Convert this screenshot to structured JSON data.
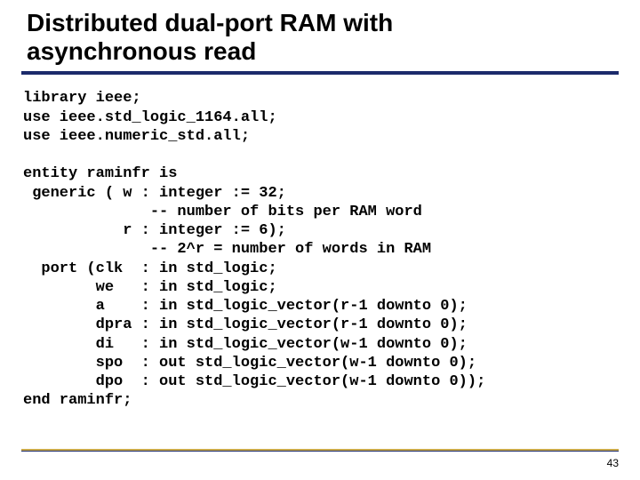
{
  "title_line1": "Distributed dual-port RAM with",
  "title_line2": "asynchronous read",
  "code_block": "library ieee;\nuse ieee.std_logic_1164.all;\nuse ieee.numeric_std.all;\n\nentity raminfr is\n generic ( w : integer := 32;\n              -- number of bits per RAM word\n           r : integer := 6);\n              -- 2^r = number of words in RAM\n  port (clk  : in std_logic;\n        we   : in std_logic;\n        a    : in std_logic_vector(r-1 downto 0);\n        dpra : in std_logic_vector(r-1 downto 0);\n        di   : in std_logic_vector(w-1 downto 0);\n        spo  : out std_logic_vector(w-1 downto 0);\n        dpo  : out std_logic_vector(w-1 downto 0));\nend raminfr;",
  "page_number": "43"
}
